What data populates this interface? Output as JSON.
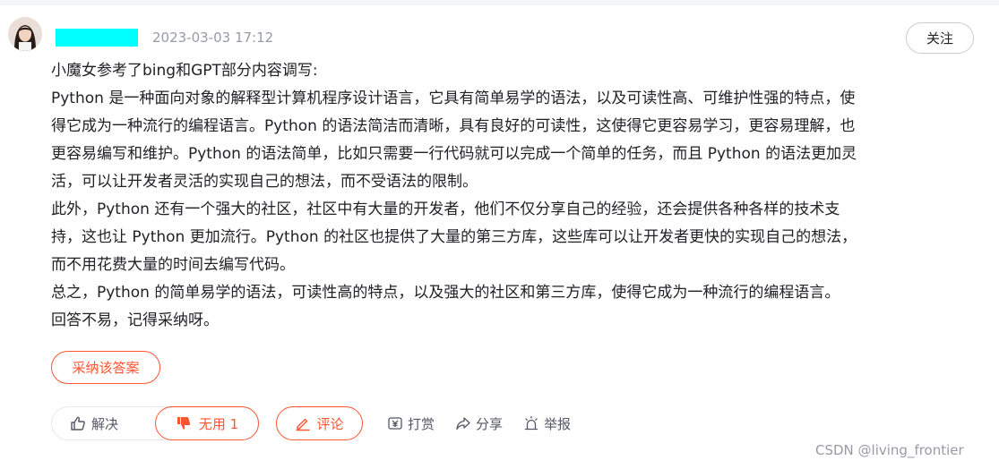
{
  "header": {
    "timestamp": "2023-03-03 17:12",
    "follow_label": "关注"
  },
  "answer": {
    "lines": [
      "小魔女参考了bing和GPT部分内容调写:",
      "Python 是一种面向对象的解释型计算机程序设计语言，它具有简单易学的语法，以及可读性高、可维护性强的特点，使",
      "得它成为一种流行的编程语言。Python 的语法简洁而清晰，具有良好的可读性，这使得它更容易学习，更容易理解，也",
      "更容易编写和维护。Python 的语法简单，比如只需要一行代码就可以完成一个简单的任务，而且 Python 的语法更加灵",
      "活，可以让开发者灵活的实现自己的想法，而不受语法的限制。",
      "此外，Python 还有一个强大的社区，社区中有大量的开发者，他们不仅分享自己的经验，还会提供各种各样的技术支",
      "持，这也让 Python 更加流行。Python 的社区也提供了大量的第三方库，这些库可以让开发者更快的实现自己的想法，",
      "而不用花费大量的时间去编写代码。",
      "总之，Python 的简单易学的语法，可读性高的特点，以及强大的社区和第三方库，使得它成为一种流行的编程语言。",
      "回答不易，记得采纳呀。"
    ],
    "accept_label": "采纳该答案"
  },
  "actions": {
    "useful_label": "解决",
    "useless_label": "无用 1",
    "comment_label": "评论",
    "reward_label": "打赏",
    "share_label": "分享",
    "report_label": "举报"
  },
  "watermark": "CSDN @living_frontier",
  "colors": {
    "accent": "#fc5531",
    "text": "#222226",
    "muted": "#999aaa",
    "mask": "#00ffff"
  }
}
